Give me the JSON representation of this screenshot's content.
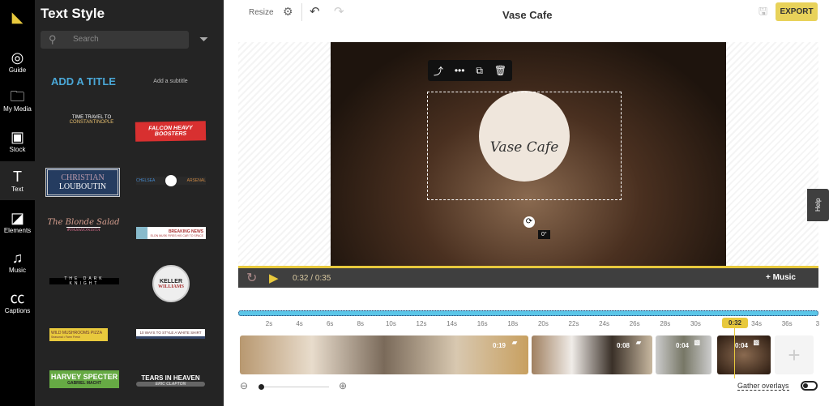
{
  "rail": {
    "items": [
      {
        "label": "Guide",
        "icon": "lightbulb-icon"
      },
      {
        "label": "My Media",
        "icon": "folder-upload-icon"
      },
      {
        "label": "Stock",
        "icon": "film-icon"
      },
      {
        "label": "Text",
        "icon": "text-icon"
      },
      {
        "label": "Elements",
        "icon": "shapes-icon"
      },
      {
        "label": "Music",
        "icon": "music-icon"
      },
      {
        "label": "Captions",
        "icon": "captions-icon"
      }
    ]
  },
  "panel": {
    "title": "Text Style",
    "search_placeholder": "Search",
    "styles": [
      {
        "text": "ADD A TITLE"
      },
      {
        "text": "Add a subtitle"
      },
      {
        "text": "TIME TRAVEL TO",
        "sub": "CONSTANTINOPLE"
      },
      {
        "text": "FALCON HEAVY",
        "sub": "BOOSTERS"
      },
      {
        "text": "CHRISTIAN",
        "sub": "LOUBOUTIN"
      },
      {
        "text": "CHELSEA",
        "sub": "ARSENAL"
      },
      {
        "text": "The Blonde Salad",
        "sub": "#FASHIONISTA"
      },
      {
        "text": "BREAKING NEWS",
        "sub": "ELON MUSK FIRES HIS CAR TO SPACE"
      },
      {
        "text": "THE DARK KNIGHT"
      },
      {
        "text": "KELLER",
        "sub": "WILLIAMS"
      },
      {
        "text": "WILD MUSHROOMS PIZZA",
        "sub": "Seasonal • Farm Fresh"
      },
      {
        "text": "10 WAYS TO STYLE A WHITE SHIRT"
      },
      {
        "text": "HARVEY SPECTER",
        "sub": "GABRIEL MACHT"
      },
      {
        "text": "TEARS IN HEAVEN",
        "sub": "ERIC CLAPTON"
      }
    ]
  },
  "topbar": {
    "resize": "Resize",
    "title": "Vase Cafe",
    "export": "EXPORT"
  },
  "canvas": {
    "logo_text": "Vase Cafe",
    "rotation": "0°",
    "help": "Help"
  },
  "player": {
    "current": "0:32",
    "sep": "/",
    "total": "0:35",
    "music": "+ Music",
    "progress_percent": 91
  },
  "timeline": {
    "ticks": [
      "2s",
      "4s",
      "6s",
      "8s",
      "10s",
      "12s",
      "14s",
      "16s",
      "18s",
      "20s",
      "22s",
      "24s",
      "26s",
      "28s",
      "30s",
      "34s",
      "36s",
      "3"
    ],
    "playhead": "0:32",
    "clips": [
      {
        "duration": "0:19",
        "type": "video"
      },
      {
        "duration": "0:08",
        "type": "video"
      },
      {
        "duration": "0:04",
        "type": "image"
      },
      {
        "duration": "0:04",
        "type": "image"
      }
    ],
    "gather": "Gather overlays"
  },
  "colors": {
    "accent": "#e8c93d",
    "track": "#5bc6e8",
    "rail": "#000000",
    "panel": "#242424"
  }
}
